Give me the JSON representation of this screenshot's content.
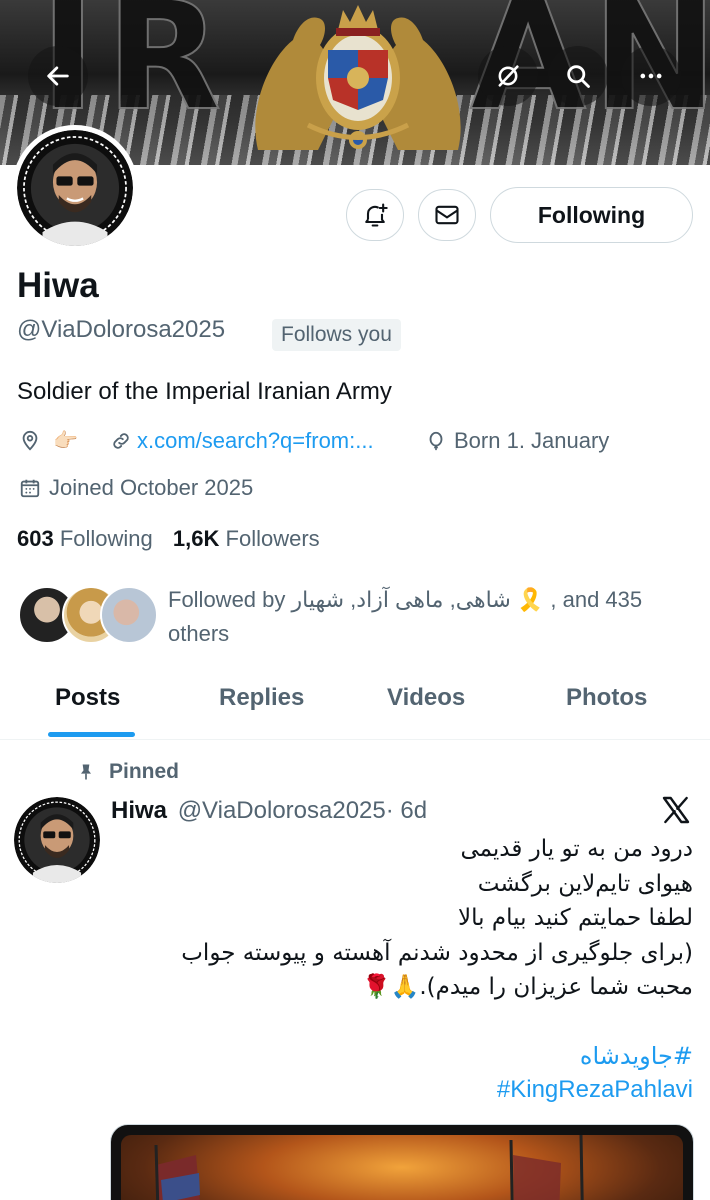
{
  "banner": {
    "text_left": "IR",
    "text_right": "AN"
  },
  "header_buttons": {
    "back": "back-arrow-icon",
    "grok": "grok-icon",
    "search": "search-icon",
    "more": "more-icon"
  },
  "profile": {
    "name": "Hiwa",
    "handle": "@ViaDolorosa2025",
    "follows_you": "Follows you",
    "bio": "Soldier of the Imperial Iranian Army",
    "location_emoji": "👉🏻",
    "link": "x.com/search?q=from:...",
    "birthday": "Born 1. January",
    "joined": "Joined October 2025",
    "following_count": "603",
    "following_label": "Following",
    "followers_count": "1,6K",
    "followers_label": "Followers",
    "followed_by_line1": "Followed by شاهی, ماهی آزاد, شهیار 🎗️ , and 435",
    "followed_by_line2": "others"
  },
  "actions": {
    "follow_label": "Following"
  },
  "tabs": [
    "Posts",
    "Replies",
    "Videos",
    "Photos"
  ],
  "post": {
    "pinned_label": "Pinned",
    "author": "Hiwa",
    "handle": "@ViaDolorosa2025",
    "time": "· 6d",
    "lines": [
      "درود من به تو یار قدیمی",
      "هیوای تایم‌لاین برگشت",
      "لطفا حمایتم کنید بیام بالا",
      "(برای جلوگیری از محدود شدنم آهسته و پیوسته جواب",
      "محبت شما عزیزان را میدم).🙏🌹"
    ],
    "hashtags": [
      "#جاویدشاه",
      "#KingRezaPahlavi"
    ]
  },
  "colors": {
    "accent": "#1d9bf0",
    "text": "#0f1419",
    "secondary": "#536471",
    "border": "#cfd9de"
  }
}
